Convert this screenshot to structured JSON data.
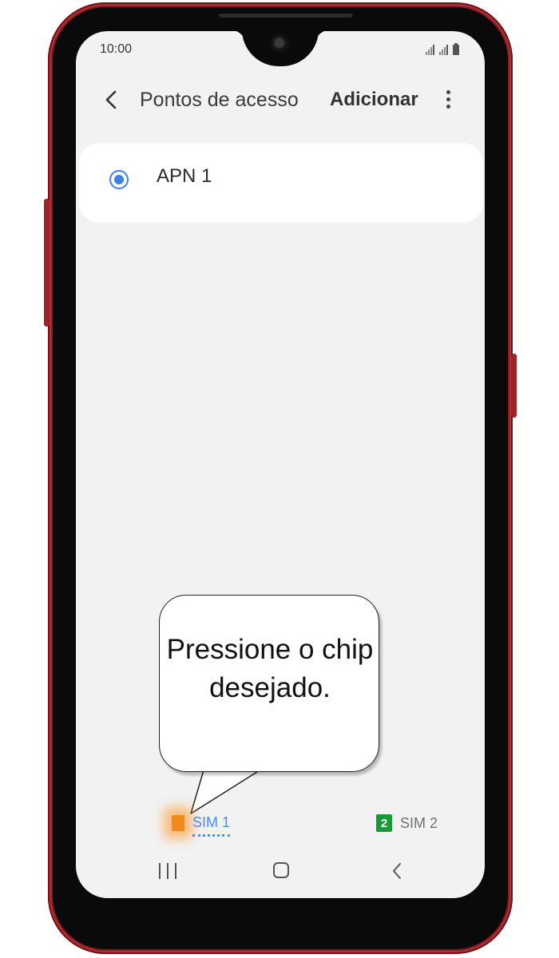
{
  "status_bar": {
    "time": "10:00"
  },
  "header": {
    "back_icon": "chevron-left-icon",
    "title": "Pontos de acesso",
    "add_label": "Adicionar",
    "more_icon": "more-vertical-icon"
  },
  "apn_list": [
    {
      "name": "APN 1",
      "selected": true
    }
  ],
  "callout": {
    "text": "Pressione o chip desejado."
  },
  "sim_tabs": [
    {
      "label": "SIM 1",
      "icon": "sim-card-icon",
      "selected": true,
      "color": "#4b8df0",
      "icon_color": "#f08a1a"
    },
    {
      "label": "SIM 2",
      "icon_text": "2",
      "selected": false,
      "color": "#707070",
      "icon_color": "#169a3a"
    }
  ],
  "nav_bar": {
    "recent_icon": "recent-apps-icon",
    "home_icon": "home-icon",
    "back_icon": "back-icon"
  },
  "colors": {
    "phone_body": "#8a1b1f",
    "screen_bg": "#f2f2f2",
    "accent": "#3d7ff0"
  }
}
